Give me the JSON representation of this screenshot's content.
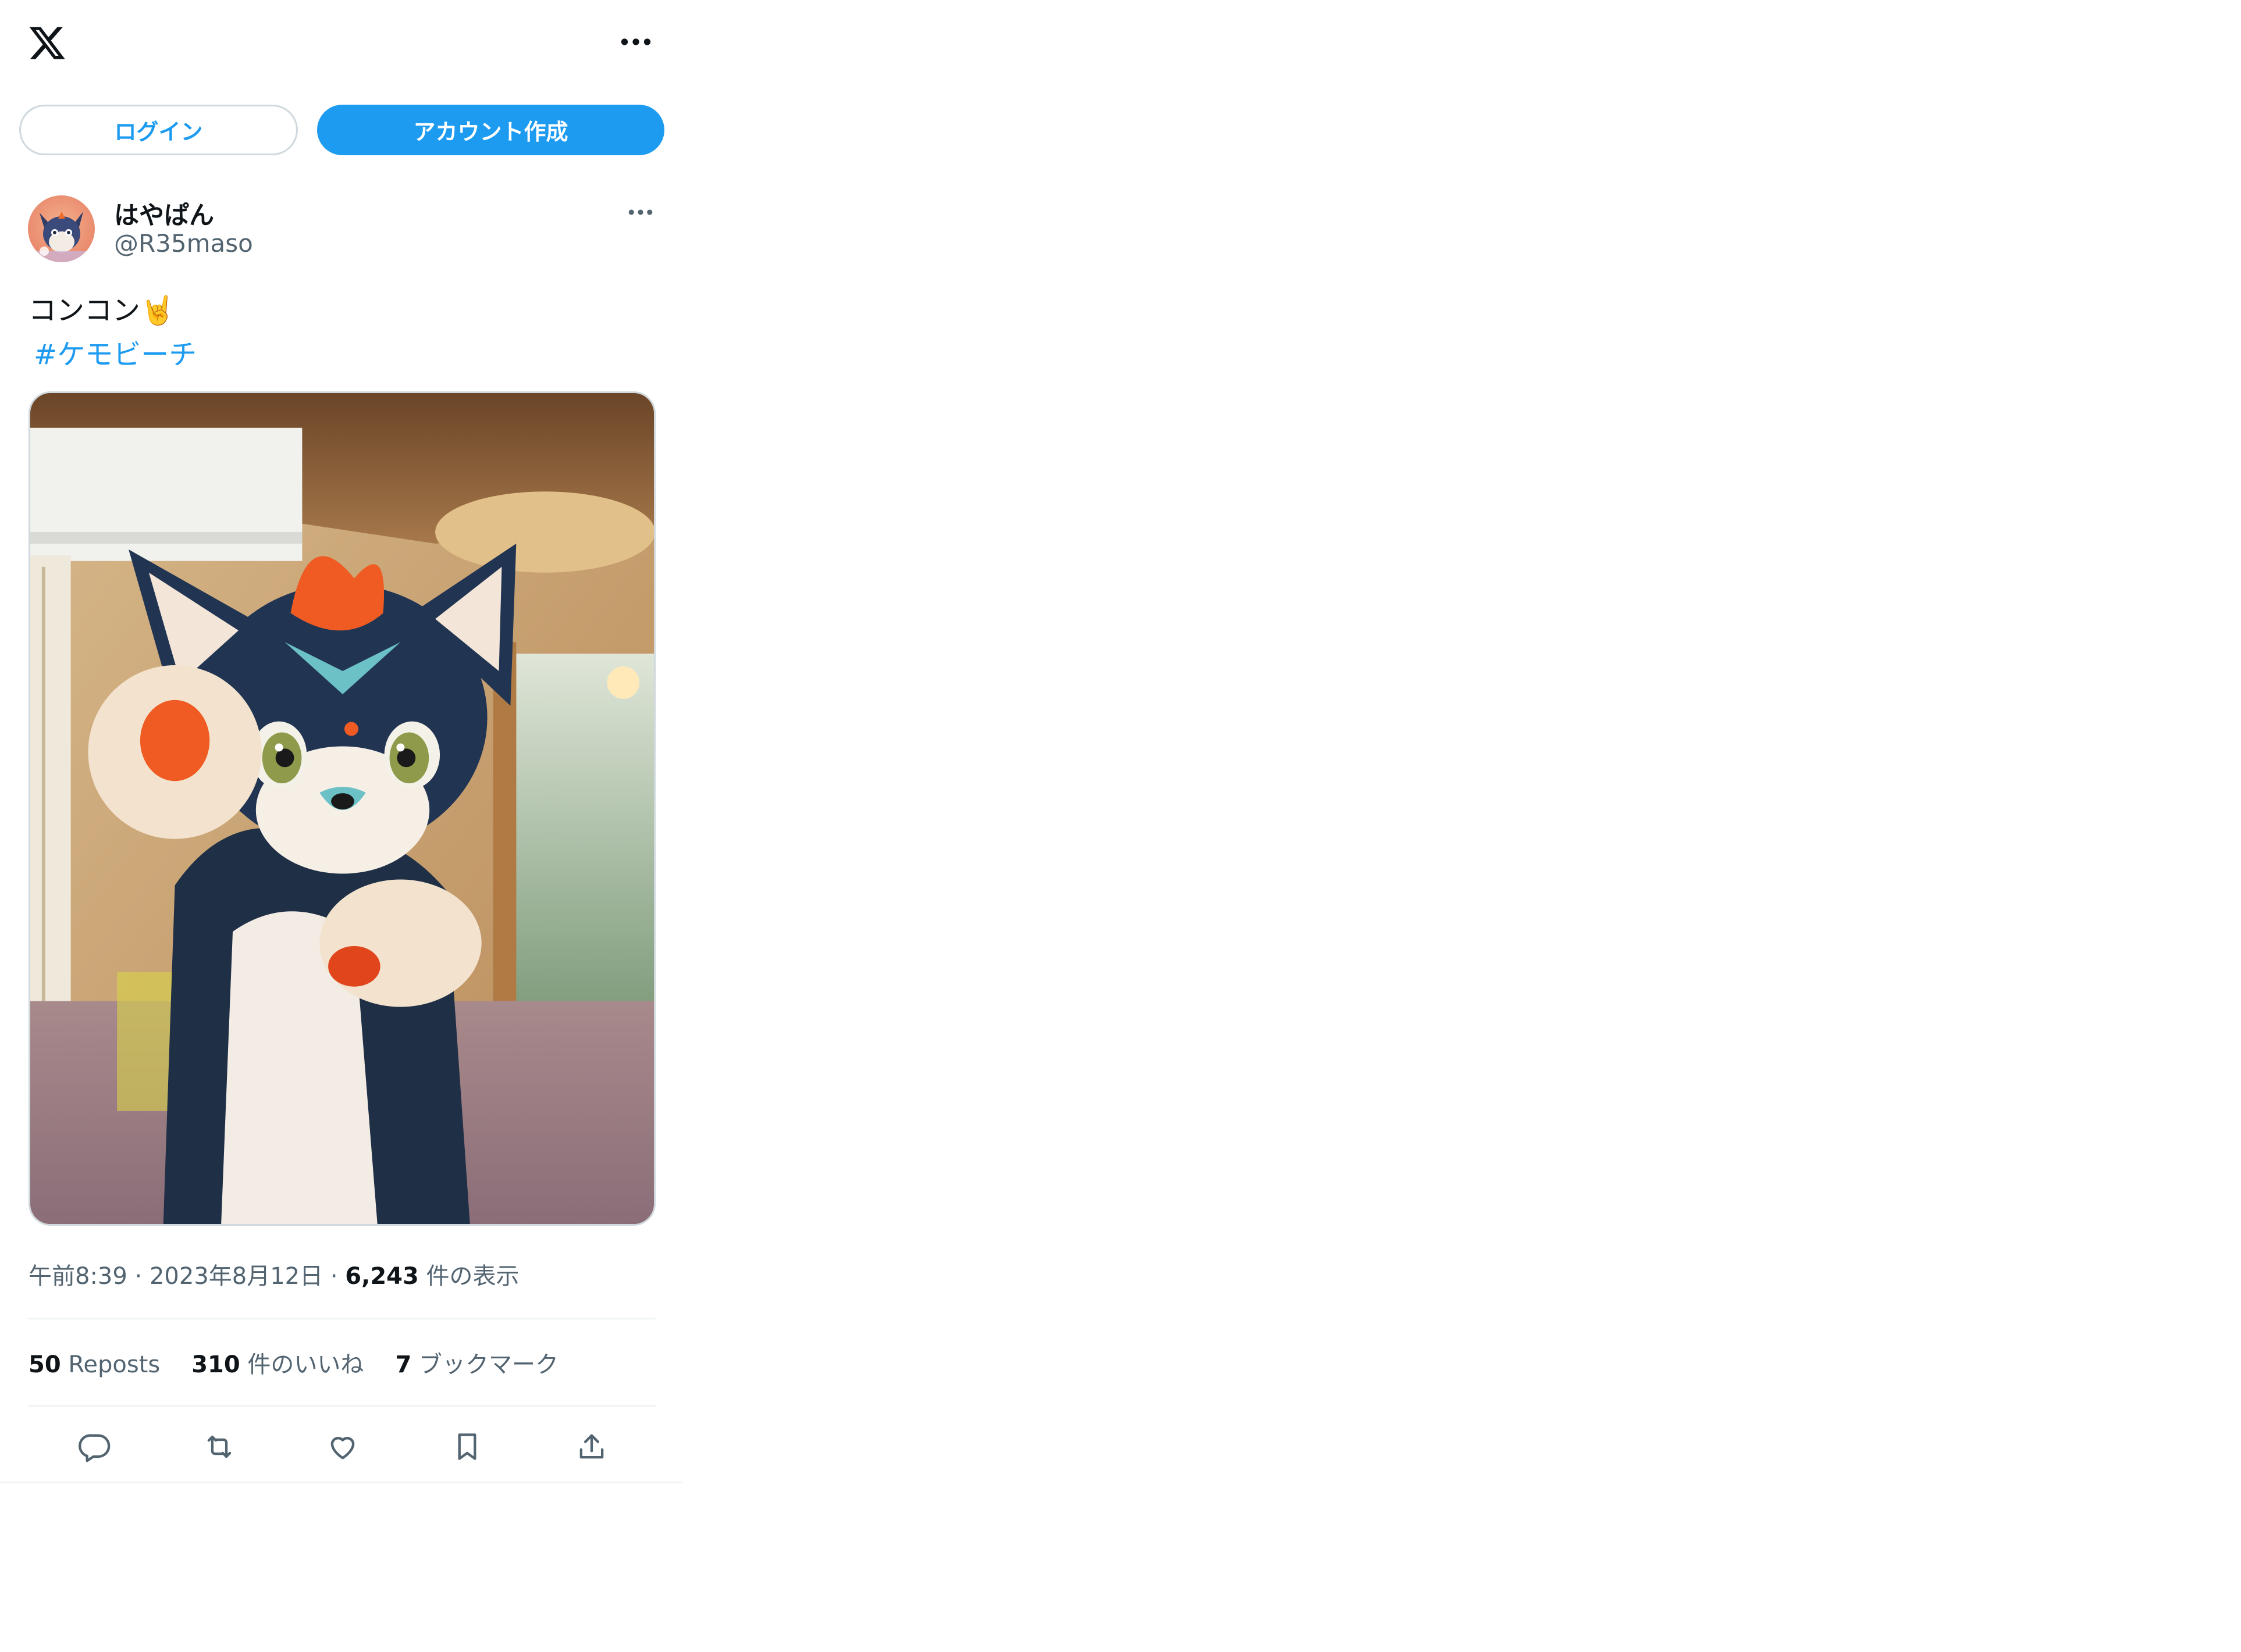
{
  "topbar": {
    "logo": "x-logo-icon",
    "more": "more-horizontal-icon"
  },
  "auth": {
    "login_label": "ログイン",
    "signup_label": "アカウント作成"
  },
  "tweet": {
    "author": {
      "display_name": "はやぱん",
      "handle": "@R35maso",
      "avatar": "avatar-image"
    },
    "text": "コンコン🤘",
    "hashtag": "#ケモビーチ",
    "media": "photo",
    "time": "午前8:39",
    "separator": " · ",
    "date": "2023年8月12日",
    "separator2": " · ",
    "views_count": "6,243",
    "views_label": " 件の表示",
    "stats": {
      "reposts_count": "50",
      "reposts_label": " Reposts",
      "likes_count": "310",
      "likes_label": " 件のいいね",
      "bookmarks_count": "7",
      "bookmarks_label": " ブックマーク"
    },
    "actions": [
      "reply-icon",
      "repost-icon",
      "like-icon",
      "bookmark-icon",
      "share-icon"
    ]
  },
  "colors": {
    "accent": "#1d9bf0",
    "text": "#0f1419",
    "secondary": "#536471",
    "border": "#cfd9de",
    "divider": "#eff3f4"
  }
}
